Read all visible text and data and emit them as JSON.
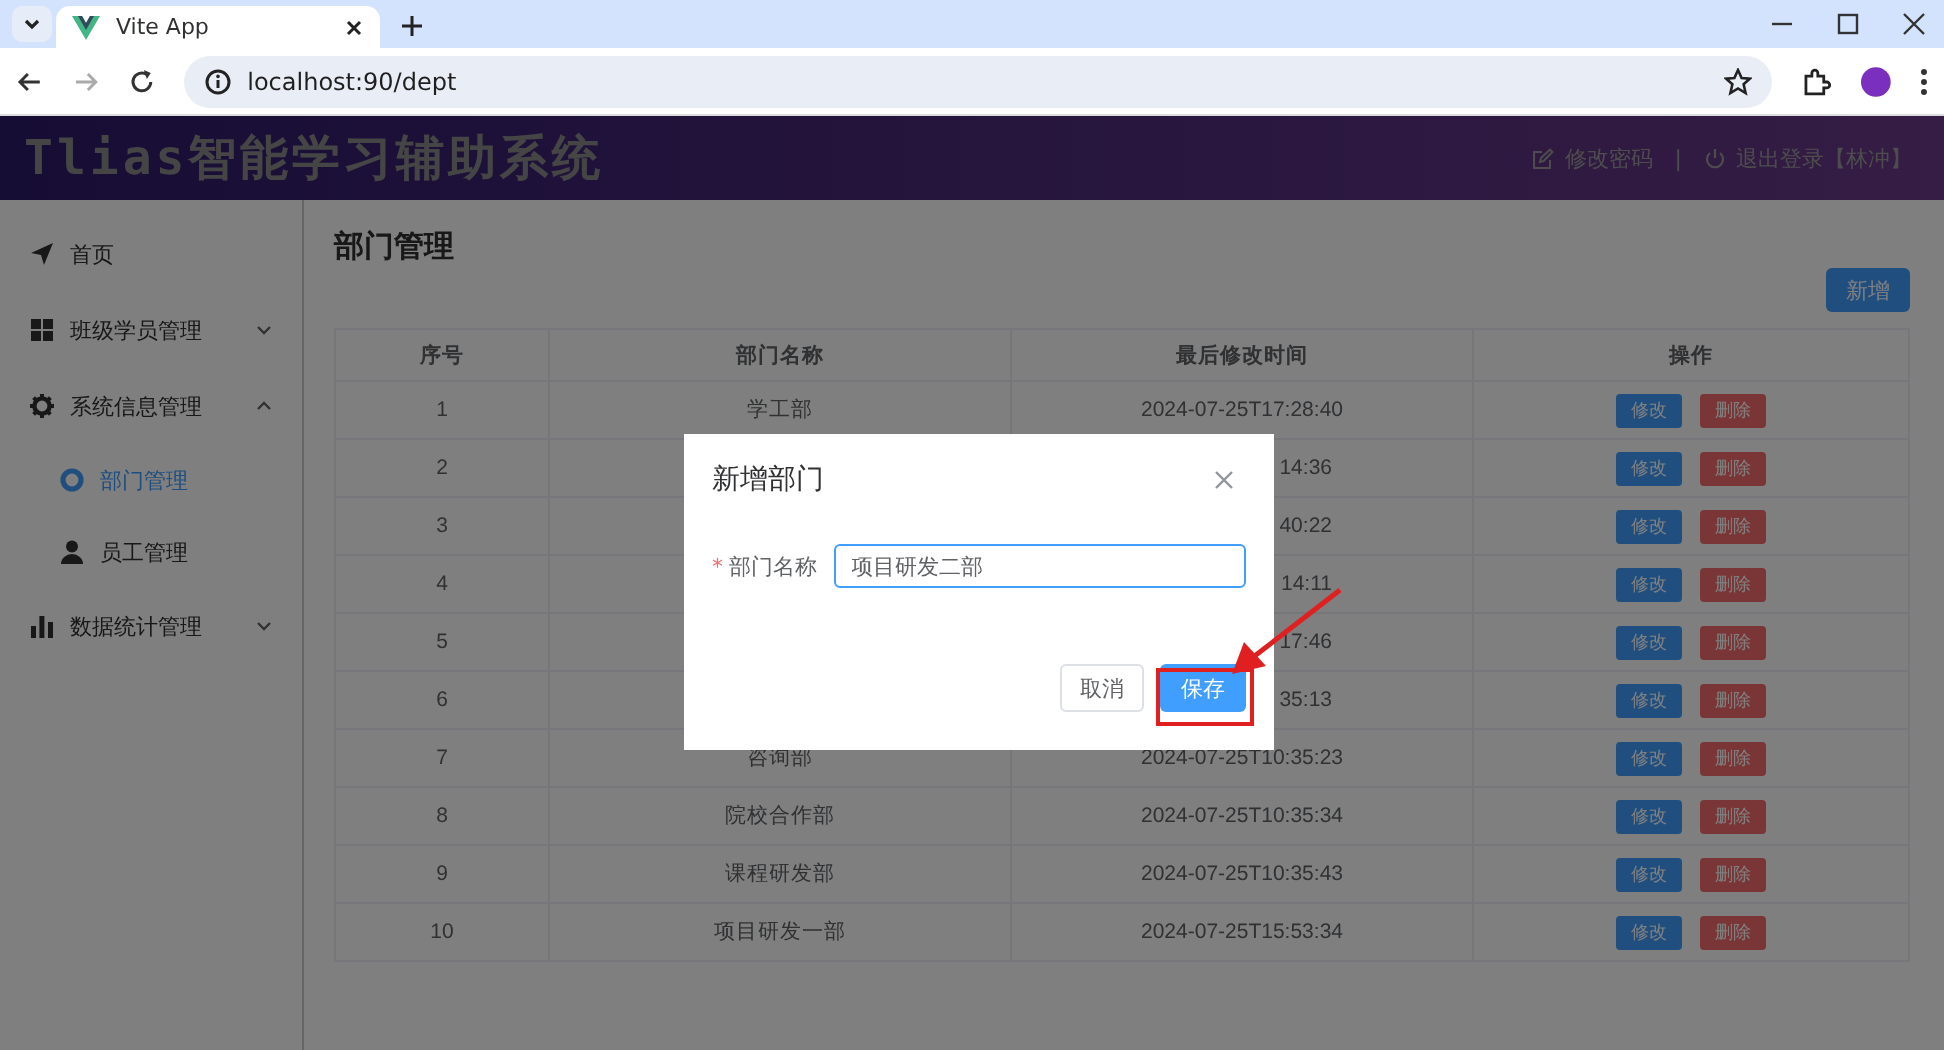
{
  "browser": {
    "tab_title": "Vite App",
    "url": "localhost:90/dept"
  },
  "header": {
    "title": "Tlias智能学习辅助系统",
    "change_password": "修改密码",
    "separator": "|",
    "logout": "退出登录【林冲】"
  },
  "sidebar": {
    "items": [
      {
        "kind": "link",
        "label": "首页",
        "selected": false
      },
      {
        "kind": "submenu",
        "label": "班级学员管理",
        "expanded": false
      },
      {
        "kind": "submenu",
        "label": "系统信息管理",
        "expanded": true,
        "children": [
          {
            "label": "部门管理",
            "selected": true
          },
          {
            "label": "员工管理",
            "selected": false
          }
        ]
      },
      {
        "kind": "submenu",
        "label": "数据统计管理",
        "expanded": false
      }
    ]
  },
  "page": {
    "title": "部门管理",
    "add_button": "新增",
    "table": {
      "columns": [
        "序号",
        "部门名称",
        "最后修改时间",
        "操作"
      ],
      "rows": [
        {
          "index": "1",
          "name": "学工部",
          "time": "2024-07-25T17:28:40",
          "actions": [
            "修改",
            "删除"
          ]
        },
        {
          "index": "2",
          "time": "14:36",
          "actions": [
            "修改",
            "删除"
          ]
        },
        {
          "index": "3",
          "time": "40:22",
          "actions": [
            "修改",
            "删除"
          ]
        },
        {
          "index": "4",
          "time": "14:11",
          "actions": [
            "修改",
            "删除"
          ]
        },
        {
          "index": "5",
          "time": "17:46",
          "actions": [
            "修改",
            "删除"
          ]
        },
        {
          "index": "6",
          "time": "35:13",
          "actions": [
            "修改",
            "删除"
          ]
        },
        {
          "index": "7",
          "name": "咨询部",
          "time": "2024-07-25T10:35:23",
          "actions": [
            "修改",
            "删除"
          ]
        },
        {
          "index": "8",
          "name": "院校合作部",
          "time": "2024-07-25T10:35:34",
          "actions": [
            "修改",
            "删除"
          ]
        },
        {
          "index": "9",
          "name": "课程研发部",
          "time": "2024-07-25T10:35:43",
          "actions": [
            "修改",
            "删除"
          ]
        },
        {
          "index": "10",
          "name": "项目研发一部",
          "time": "2024-07-25T15:53:34",
          "actions": [
            "修改",
            "删除"
          ]
        }
      ]
    }
  },
  "dialog": {
    "title": "新增部门",
    "field": {
      "label": "部门名称",
      "required_mark": "*",
      "value": "项目研发二部"
    },
    "cancel": "取消",
    "save": "保存"
  }
}
